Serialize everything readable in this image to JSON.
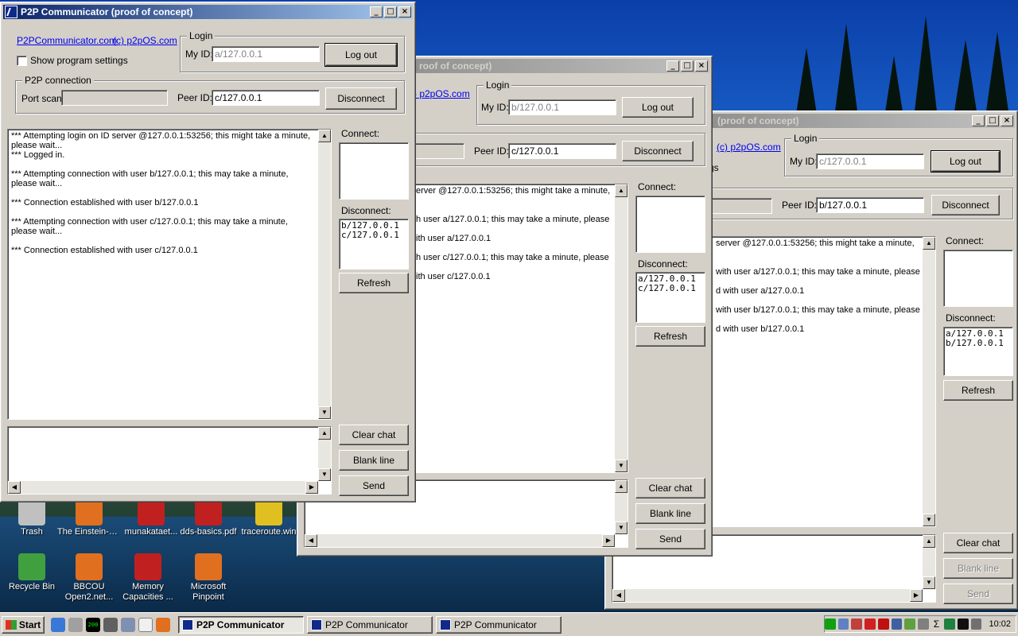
{
  "desktop": {
    "icons": [
      {
        "label": "Trash",
        "color": "#c0c0c0"
      },
      {
        "label": "The Einstein-Po...",
        "color": "#e07020"
      },
      {
        "label": "munakataet...",
        "color": "#c02020"
      },
      {
        "label": "dds-basics.pdf",
        "color": "#c02020"
      },
      {
        "label": "traceroute.win",
        "color": "#e0c020"
      },
      {
        "label": "Recycle Bin",
        "color": "#40a040"
      },
      {
        "label": "BBCOU Open2.net...",
        "color": "#e07020"
      },
      {
        "label": "Memory Capacities ...",
        "color": "#c02020"
      },
      {
        "label": "Microsoft Pinpoint",
        "color": "#e07020"
      }
    ]
  },
  "common": {
    "title": "P2P Communicator  (proof of concept)",
    "link_site": "P2PCommunicator.com",
    "link_copyright": "(c) p2pOS.com",
    "show_settings": "Show program settings",
    "login_group": "Login",
    "my_id_label": "My ID:",
    "logout": "Log out",
    "p2p_group": "P2P connection",
    "port_scan": "Port scan:",
    "peer_id_label": "Peer ID:",
    "disconnect": "Disconnect",
    "connect_list": "Connect:",
    "disconnect_list": "Disconnect:",
    "refresh": "Refresh",
    "clear_chat": "Clear chat",
    "blank_line": "Blank line",
    "send": "Send",
    "minimize": "_",
    "maximize": "□",
    "close": "×"
  },
  "windows": [
    {
      "title_visible": "P2P Communicator  (proof of concept)",
      "my_id": "a/127.0.0.1",
      "peer_id": "c/127.0.0.1",
      "log": [
        "*** Attempting login on ID server @127.0.0.1:53256; this might take a minute, please wait...",
        "*** Logged in.",
        "*** Attempting connection with user b/127.0.0.1; this may take a minute, please wait...",
        "*** Connection established with user b/127.0.0.1",
        "*** Attempting connection with user c/127.0.0.1; this may take a minute, please wait...",
        "*** Connection established with user c/127.0.0.1"
      ],
      "disconnect_items": [
        "b/127.0.0.1",
        "c/127.0.0.1"
      ]
    },
    {
      "title_visible": "roof of concept)",
      "link_visible": ") p2pOS.com",
      "my_id": "b/127.0.0.1",
      "peer_id": "c/127.0.0.1",
      "log": [
        "erver @127.0.0.1:53256; this might take a minute,",
        "h user a/127.0.0.1; this may take a minute, please",
        "ith user a/127.0.0.1",
        "h user c/127.0.0.1; this may take a minute, please",
        "ith user c/127.0.0.1"
      ],
      "disconnect_items": [
        "a/127.0.0.1",
        "c/127.0.0.1"
      ]
    },
    {
      "title_visible": "(proof of concept)",
      "settings_visible": "gs",
      "my_id": "c/127.0.0.1",
      "peer_id": "b/127.0.0.1",
      "log": [
        "server @127.0.0.1:53256; this might take a minute,",
        "with user a/127.0.0.1; this may take a minute, please",
        "d with user a/127.0.0.1",
        "with user b/127.0.0.1; this may take a minute, please",
        "d with user b/127.0.0.1"
      ],
      "disconnect_items": [
        "a/127.0.0.1",
        "b/127.0.0.1"
      ]
    }
  ],
  "taskbar": {
    "start": "Start",
    "tasks": [
      "P2P Communicator",
      "P2P Communicator",
      "P2P Communicator"
    ],
    "clock": "10:02",
    "quick_launch_label": "200"
  }
}
